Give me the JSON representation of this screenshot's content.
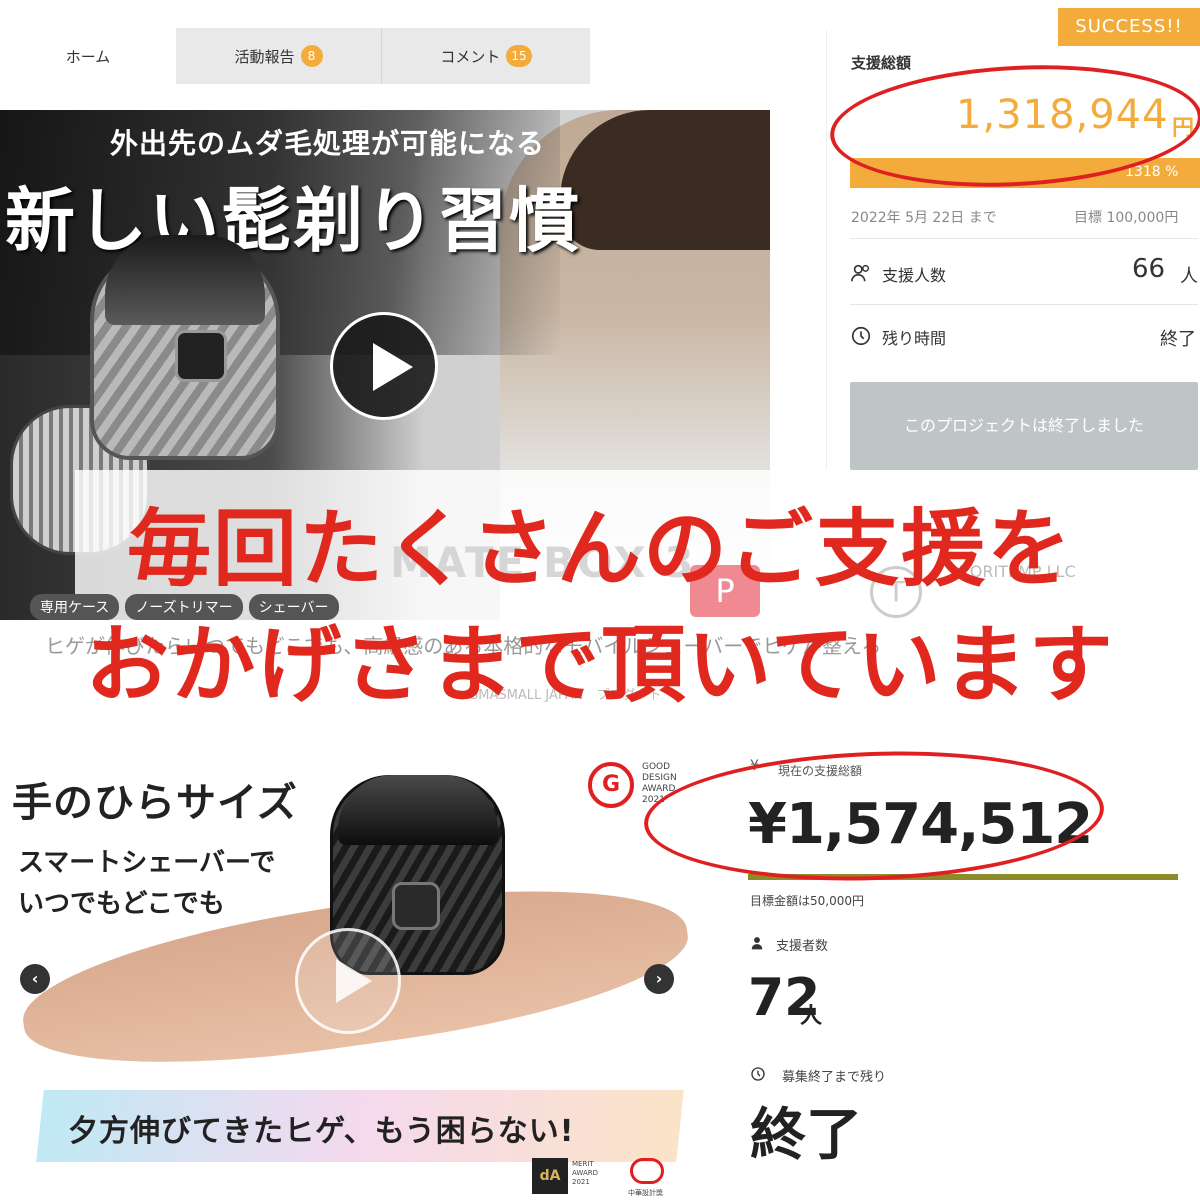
{
  "top": {
    "tabs": [
      {
        "label": "ホーム",
        "badge": ""
      },
      {
        "label": "活動報告",
        "badge": "8"
      },
      {
        "label": "コメント",
        "badge": "15"
      }
    ],
    "hero": {
      "subtitle": "外出先のムダ毛処理が可能になる",
      "title": "新しい髭剃り習慣",
      "product_name": "MATE BOX 3",
      "chips": [
        "専用ケース",
        "ノーズトリマー",
        "シェーバー"
      ],
      "description": "ヒゲが伸びたらいつでもどこでも、高級感のある本格的なモバイルシェーバーでヒゲが整える",
      "maker": "SMASMALL JAPAN　プロダクト"
    },
    "company": {
      "name": "TORITEMP LLC",
      "logo_letter": "T",
      "badge_letter": "P"
    },
    "sidebar": {
      "success_badge": "SUCCESS!!",
      "total_label": "支援総額",
      "total_amount": "1,318,944",
      "currency": "円",
      "progress_text": "1318 %",
      "progress_percent": 1318,
      "deadline": "2022年 5月 22日 まで",
      "target": "目標 100,000円",
      "supporters_label": "支援人数",
      "supporters_value": "66",
      "supporters_unit": "人",
      "remaining_label": "残り時間",
      "remaining_value": "終了",
      "ended_button": "このプロジェクトは終了しました"
    }
  },
  "message": {
    "line1": "毎回たくさんのご支援を",
    "line2": "おかげさまで頂いています"
  },
  "bottom": {
    "hero": {
      "title": "手のひらサイズ",
      "sub1": "スマートシェーバーで",
      "sub2": "いつでもどこでも",
      "banner": "夕方伸びてきたヒゲ、もう困らない!",
      "gd_award": "GOOD DESIGN AWARD 2021",
      "merit_award": "MERIT AWARD 2021",
      "chuto_award": "中華設計獎",
      "arrow_left": "‹",
      "arrow_right": "›"
    },
    "sidebar": {
      "yen_icon": "¥",
      "total_label": "現在の支援総額",
      "total_amount": "¥1,574,512",
      "target": "目標金額は50,000円",
      "supporters_label": "支援者数",
      "supporters_value": "72",
      "supporters_unit": "人",
      "remaining_label": "募集終了まで残り",
      "remaining_value": "終了"
    }
  },
  "colors": {
    "accent_orange": "#f3ac3b",
    "marker_red": "#e02020",
    "message_red": "#e0281e",
    "ended_gray": "#bfc5c6",
    "bar_olive": "#8d8a2a"
  }
}
